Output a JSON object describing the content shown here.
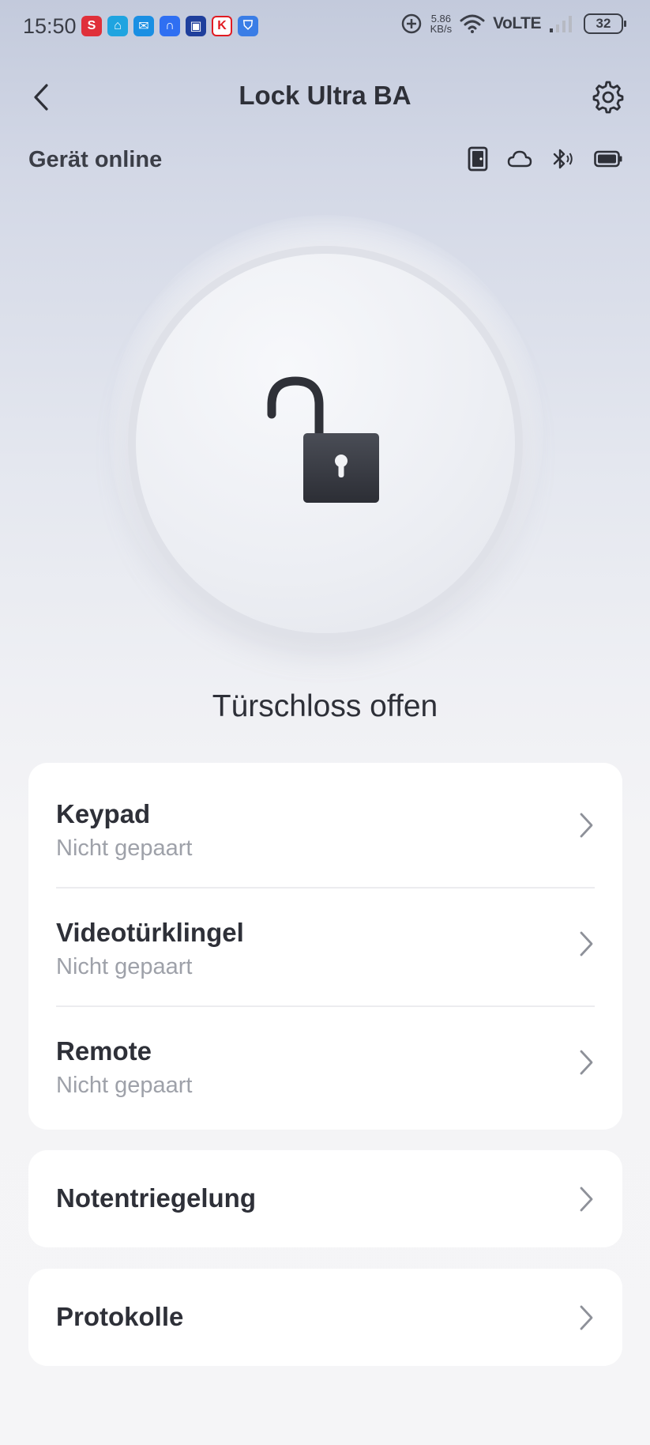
{
  "status_bar": {
    "time": "15:50",
    "apps": [
      {
        "name": "s-app-icon",
        "glyph": "S",
        "color": "#e0303a"
      },
      {
        "name": "home-app-icon",
        "glyph": "⌂",
        "color": "#1fa4e0"
      },
      {
        "name": "mail-app-icon",
        "glyph": "✉",
        "color": "#1a8fe3"
      },
      {
        "name": "smart-home-app-icon",
        "glyph": "∩",
        "color": "#2f6ff2"
      },
      {
        "name": "camera-app-icon",
        "glyph": "▣",
        "color": "#1f3f9c"
      },
      {
        "name": "kaufland-app-icon",
        "glyph": "K",
        "color": "#e11b22"
      },
      {
        "name": "shield-app-icon",
        "glyph": "⛉",
        "color": "#3a7de6"
      }
    ],
    "speed_value": "5.86",
    "speed_unit": "KB/s",
    "network": "VoLTE",
    "battery": "32"
  },
  "header": {
    "title": "Lock Ultra BA"
  },
  "device": {
    "status": "Gerät online"
  },
  "lock": {
    "status": "Türschloss offen"
  },
  "accessories": [
    {
      "title": "Keypad",
      "subtitle": "Nicht gepaart"
    },
    {
      "title": "Videotürklingel",
      "subtitle": "Nicht gepaart"
    },
    {
      "title": "Remote",
      "subtitle": "Nicht gepaart"
    }
  ],
  "emergency": {
    "title": "Notentriegelung"
  },
  "logs": {
    "title": "Protokolle"
  },
  "colors": {
    "text": "#2e3038",
    "subtext": "#9ea1a9",
    "card": "#ffffff",
    "lock_body": "#3a3c44"
  }
}
